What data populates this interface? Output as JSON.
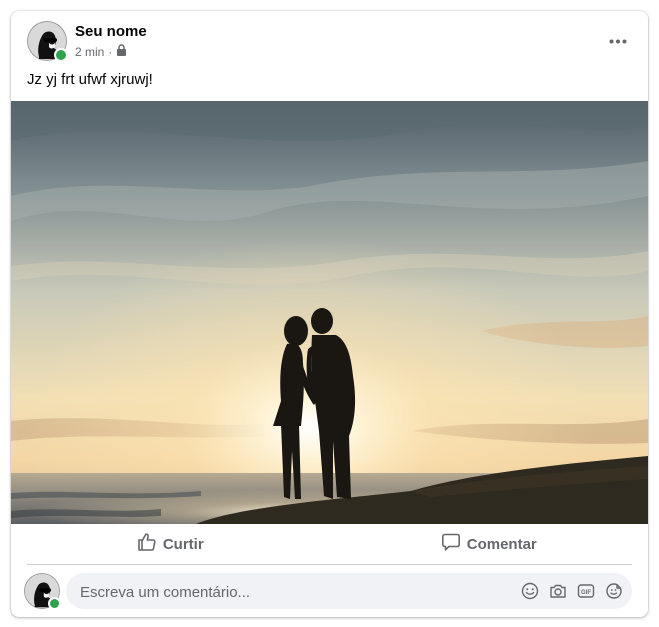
{
  "post": {
    "author": "Seu nome",
    "time": "2 min",
    "separator": "·",
    "privacy_icon": "lock-icon",
    "text": "Jz yj frt ufwf xjruwj!",
    "options_icon": "more-options-icon"
  },
  "actions": {
    "like_label": "Curtir",
    "like_icon": "thumbs-up-icon",
    "comment_label": "Comentar",
    "comment_icon": "speech-bubble-icon"
  },
  "comment": {
    "placeholder": "Escreva um comentário...",
    "icons": [
      "emoji-icon",
      "camera-icon",
      "gif-icon",
      "sticker-icon"
    ]
  },
  "colors": {
    "presence": "#31a24c",
    "secondary_text": "#65676b",
    "comment_bg": "#f0f2f5"
  }
}
